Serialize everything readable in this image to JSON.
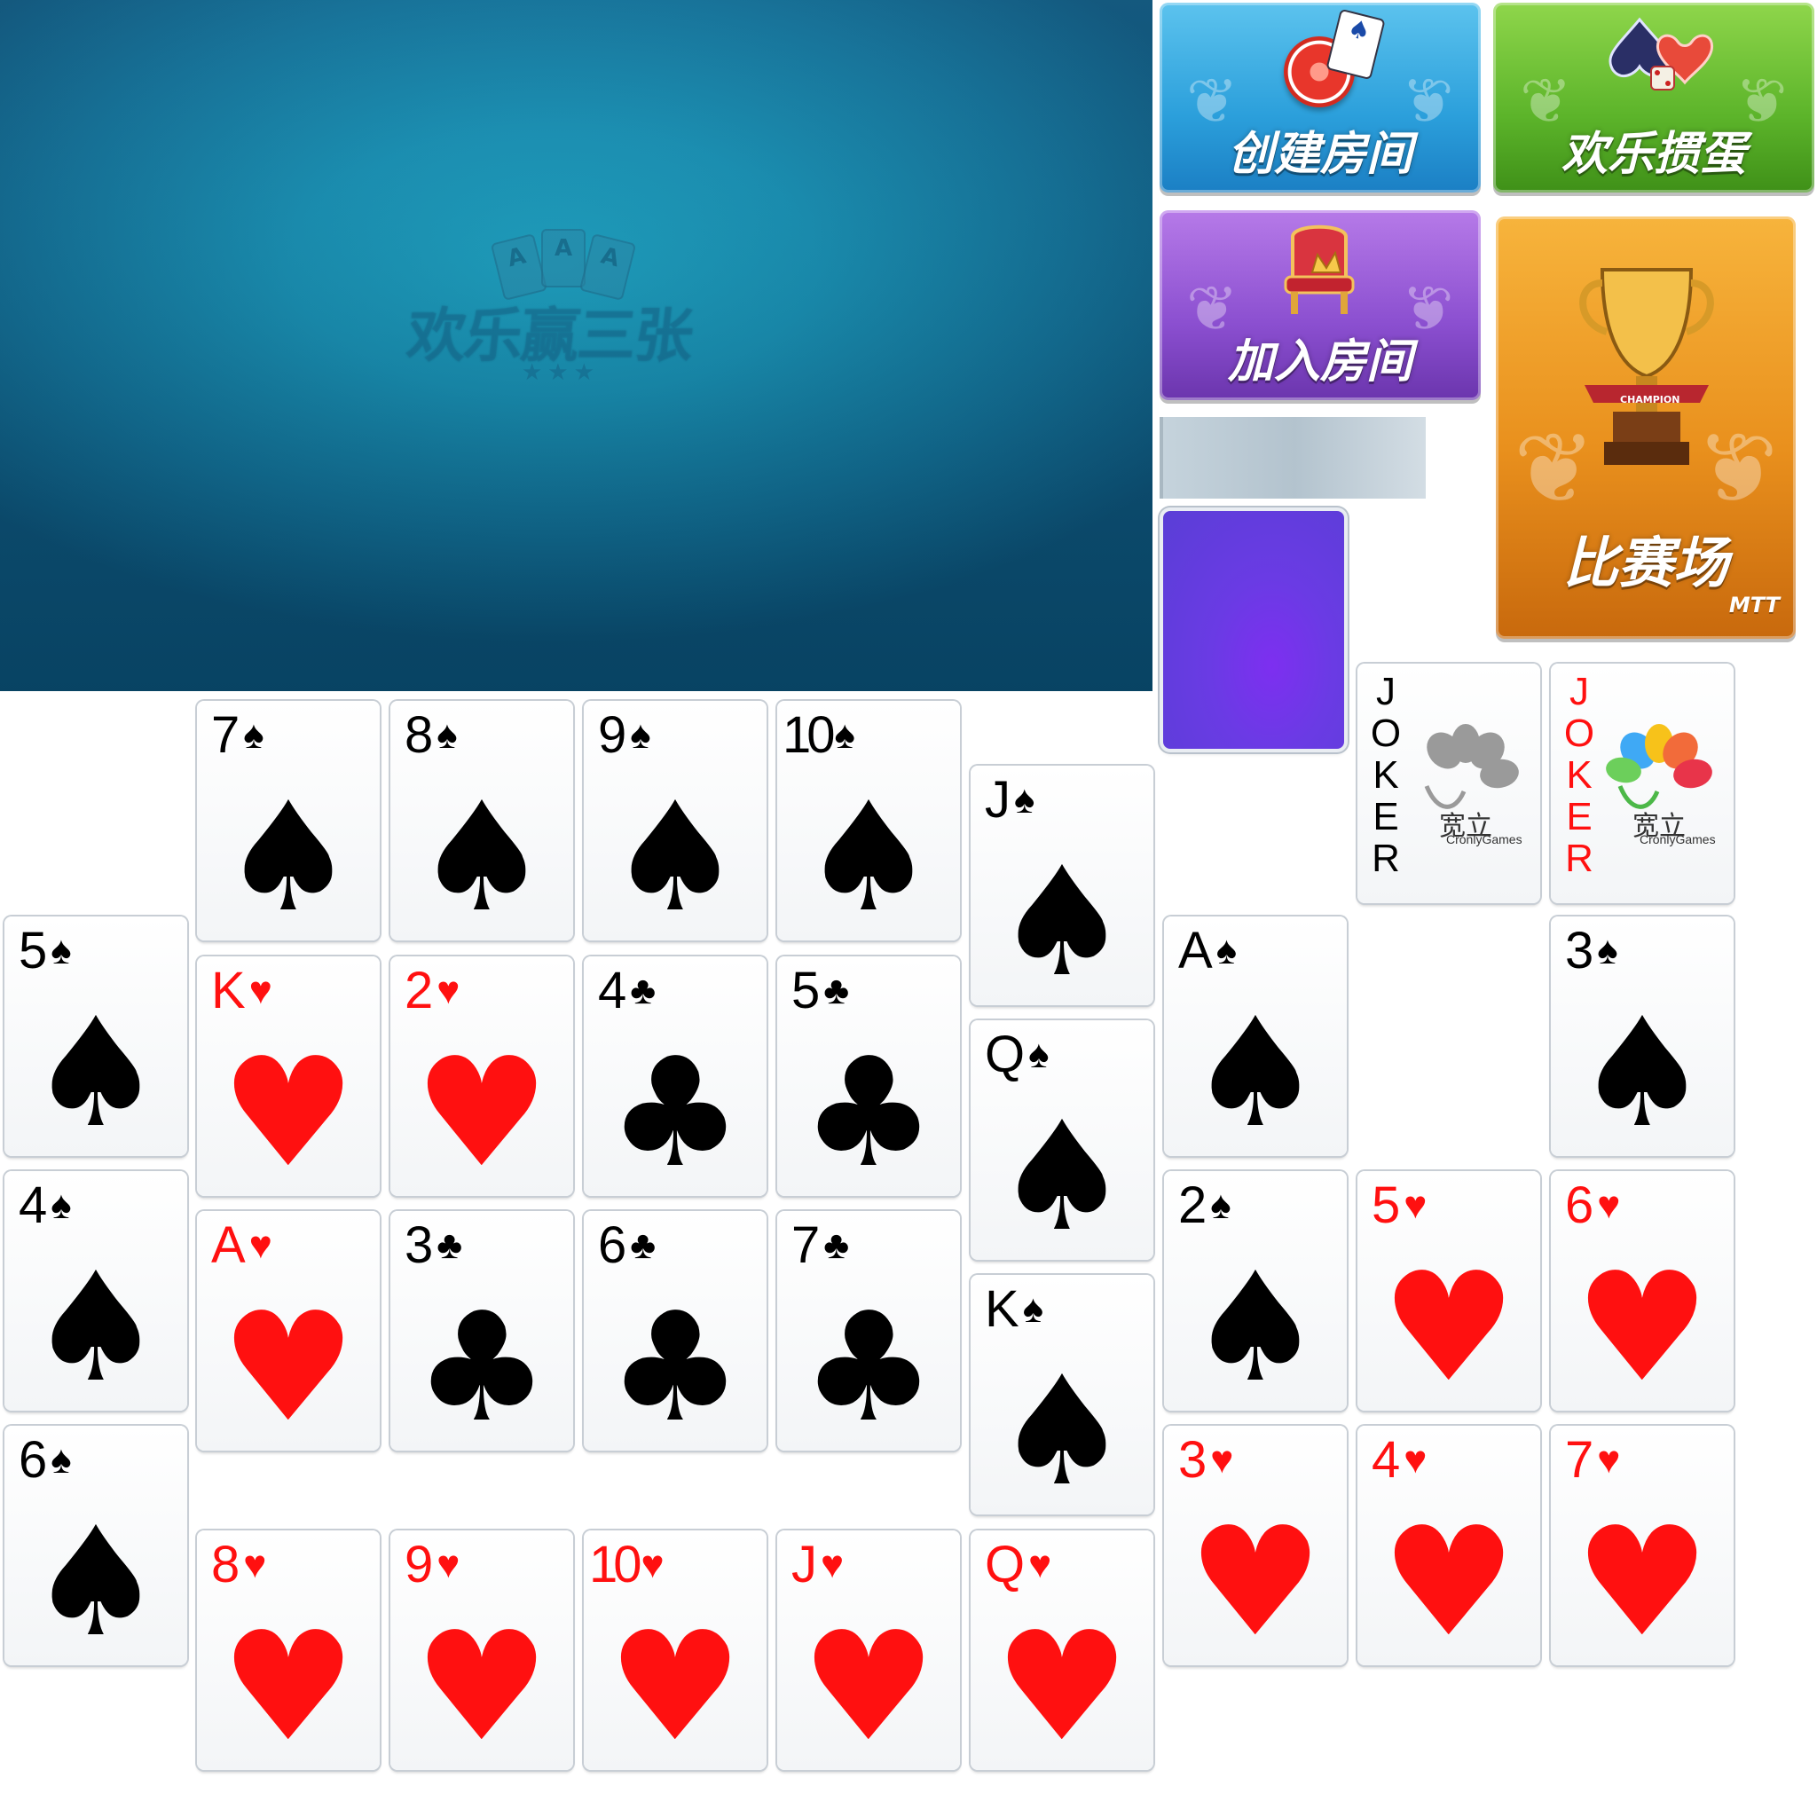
{
  "table": {
    "watermark_text": "欢乐赢三张",
    "watermark_cards": [
      "A",
      "A",
      "A"
    ],
    "watermark_stars": "★★★"
  },
  "menu": {
    "create_room": "创建房间",
    "happy_guandan": "欢乐掼蛋",
    "join_room": "加入房间",
    "match_arena": "比赛场",
    "match_badge": "MTT",
    "trophy_ribbon": "CHAMPION"
  },
  "jokers": [
    {
      "letters": [
        "J",
        "O",
        "K",
        "E",
        "R"
      ],
      "color": "#000000",
      "brand_cn": "宽立",
      "brand_en": "CronlyGames"
    },
    {
      "letters": [
        "J",
        "O",
        "K",
        "E",
        "R"
      ],
      "color": "#ff1010",
      "brand_cn": "宽立",
      "brand_en": "CronlyGames"
    }
  ],
  "colors": {
    "red_suit": "#ff1010",
    "black_suit": "#000000",
    "card_back": "#6a3be4",
    "table": "#1590b5"
  },
  "cards": [
    {
      "rank": "7",
      "suit": "♠"
    },
    {
      "rank": "8",
      "suit": "♠"
    },
    {
      "rank": "9",
      "suit": "♠"
    },
    {
      "rank": "10",
      "suit": "♠"
    },
    {
      "rank": "J",
      "suit": "♠"
    },
    {
      "rank": "5",
      "suit": "♠"
    },
    {
      "rank": "K",
      "suit": "♥"
    },
    {
      "rank": "2",
      "suit": "♥"
    },
    {
      "rank": "4",
      "suit": "♣"
    },
    {
      "rank": "5",
      "suit": "♣"
    },
    {
      "rank": "A",
      "suit": "♠"
    },
    {
      "rank": "3",
      "suit": "♠"
    },
    {
      "rank": "Q",
      "suit": "♠"
    },
    {
      "rank": "4",
      "suit": "♠"
    },
    {
      "rank": "A",
      "suit": "♥"
    },
    {
      "rank": "3",
      "suit": "♣"
    },
    {
      "rank": "6",
      "suit": "♣"
    },
    {
      "rank": "7",
      "suit": "♣"
    },
    {
      "rank": "K",
      "suit": "♠"
    },
    {
      "rank": "2",
      "suit": "♠"
    },
    {
      "rank": "5",
      "suit": "♥"
    },
    {
      "rank": "6",
      "suit": "♥"
    },
    {
      "rank": "6",
      "suit": "♠"
    },
    {
      "rank": "3",
      "suit": "♥"
    },
    {
      "rank": "4",
      "suit": "♥"
    },
    {
      "rank": "7",
      "suit": "♥"
    },
    {
      "rank": "8",
      "suit": "♥"
    },
    {
      "rank": "9",
      "suit": "♥"
    },
    {
      "rank": "10",
      "suit": "♥"
    },
    {
      "rank": "J",
      "suit": "♥"
    },
    {
      "rank": "Q",
      "suit": "♥"
    }
  ]
}
